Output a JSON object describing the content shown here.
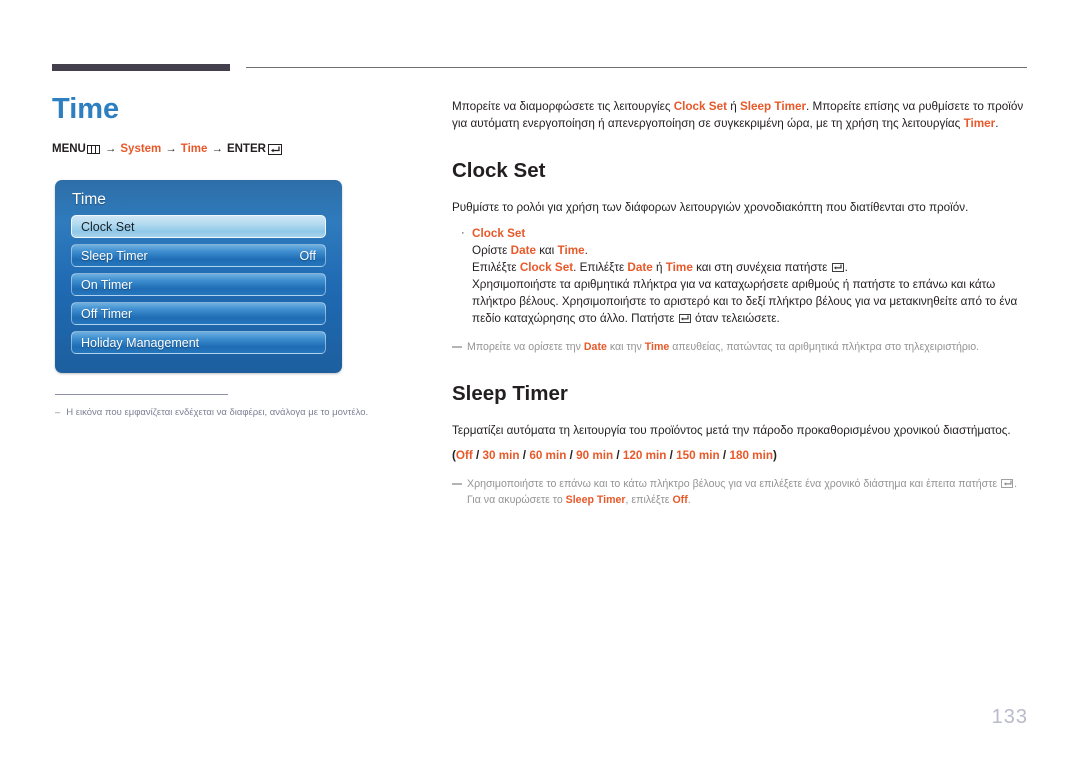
{
  "page_title": "Time",
  "breadcrumb": {
    "menu_label": "MENU",
    "menu_icon": "menu-bars-icon",
    "arrow": "→",
    "crumb1": "System",
    "crumb2": "Time",
    "enter_label": "ENTER",
    "enter_icon": "enter-key-icon"
  },
  "osd": {
    "title": "Time",
    "items": [
      {
        "label": "Clock Set",
        "value": "",
        "selected": true
      },
      {
        "label": "Sleep Timer",
        "value": "Off",
        "selected": false
      },
      {
        "label": "On Timer",
        "value": "",
        "selected": false
      },
      {
        "label": "Off Timer",
        "value": "",
        "selected": false
      },
      {
        "label": "Holiday Management",
        "value": "",
        "selected": false
      }
    ]
  },
  "left_footnote": {
    "dash": "–",
    "text": "Η εικόνα που εμφανίζεται ενδέχεται να διαφέρει, ανάλογα με το μοντέλο."
  },
  "intro": {
    "part1": "Μπορείτε να διαμορφώσετε τις λειτουργίες ",
    "accent1": "Clock Set",
    "part2": " ή ",
    "accent2": "Sleep Timer",
    "part3": ". Μπορείτε επίσης να ρυθμίσετε το προϊόν για αυτόματη ενεργοποίηση ή απενεργοποίηση σε συγκεκριμένη ώρα, με τη χρήση της λειτουργίας ",
    "accent3": "Timer",
    "part4": "."
  },
  "clock_set": {
    "heading": "Clock Set",
    "description": "Ρυθμίστε το ρολόι για χρήση των διάφορων λειτουργιών χρονοδιακόπτη που διατίθενται στο προϊόν.",
    "bullet_dot": "·",
    "bullet_head": "Clock Set",
    "line1": {
      "a": "Ορίστε ",
      "accent1": "Date",
      "b": " και ",
      "accent2": "Time",
      "c": "."
    },
    "line2": {
      "a": "Επιλέξτε ",
      "accent1": "Clock Set",
      "b": ". Επιλέξτε ",
      "accent2": "Date",
      "c": " ή ",
      "accent3": "Time",
      "d": " και στη συνέχεια πατήστε ",
      "e": "."
    },
    "line3": {
      "a": "Χρησιμοποιήστε τα αριθμητικά πλήκτρα για να καταχωρήσετε αριθμούς ή πατήστε το επάνω και κάτω πλήκτρο βέλους. Χρησιμοποιήστε το αριστερό και το δεξί πλήκτρο βέλους για να μετακινηθείτε από το ένα πεδίο καταχώρησης στο άλλο. Πατήστε ",
      "b": " όταν τελειώσετε."
    },
    "note": {
      "a": "Μπορείτε να ορίσετε την ",
      "accent1": "Date",
      "b": " και την ",
      "accent2": "Time",
      "c": " απευθείας, πατώντας τα αριθμητικά πλήκτρα στο τηλεχειριστήριο."
    }
  },
  "sleep_timer": {
    "heading": "Sleep Timer",
    "description": "Τερματίζει αυτόματα τη λειτουργία του προϊόντος μετά την πάροδο προκαθορισμένου χρονικού διαστήματος.",
    "options_open": "(",
    "options": [
      "Off",
      "30 min",
      "60 min",
      "90 min",
      "120 min",
      "150 min",
      "180 min"
    ],
    "options_sep": " / ",
    "options_close": ")",
    "note": {
      "a": "Χρησιμοποιήστε το επάνω και το κάτω πλήκτρο βέλους για να επιλέξετε ένα χρονικό διάστημα και έπειτα πατήστε ",
      "b": ". Για να ακυρώσετε το ",
      "accent1": "Sleep Timer",
      "c": ", επιλέξτε ",
      "accent2": "Off",
      "d": "."
    }
  },
  "page_number": "133",
  "colors": {
    "accent_orange": "#e8592a",
    "title_blue": "#2e7fc0",
    "rule_dark": "#433f4c",
    "page_number_gray": "#b9bacb",
    "note_gray": "#949494"
  }
}
